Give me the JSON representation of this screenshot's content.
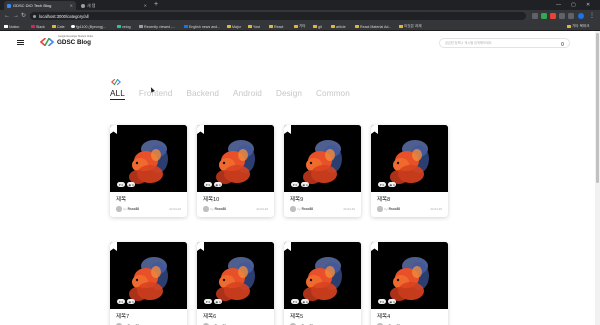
{
  "browser": {
    "tabs": [
      {
        "title": "GDSC DIO Tech Blog",
        "favicon_color": "#4285f4"
      },
      {
        "title": "새 탭",
        "favicon_color": "#9aa0a6"
      }
    ],
    "new_tab": "+",
    "window_controls": [
      "—",
      "▢",
      "✕"
    ],
    "url": "localhost:3000/category/all",
    "bookmarks": [
      {
        "label": "Notion",
        "color": "#ffffff"
      },
      {
        "label": "Slack",
        "color": "#e01e5a"
      },
      {
        "label": "Cafe",
        "color": "#e2b33f"
      },
      {
        "label": "fjp1100 (Byeongj...",
        "color": "#ffffff"
      },
      {
        "label": "velog",
        "color": "#20c997"
      },
      {
        "label": "Recently viewed -...",
        "color": "#9aa0a6"
      },
      {
        "label": "English news and...",
        "color": "#1a73e8"
      },
      {
        "label": "Major",
        "color": "#e2b33f"
      },
      {
        "label": "Yost",
        "color": "#e2b33f"
      },
      {
        "label": "React",
        "color": "#e2b33f"
      },
      {
        "label": "기타",
        "color": "#e2b33f"
      },
      {
        "label": "git",
        "color": "#e2b33f"
      },
      {
        "label": "article",
        "color": "#e2b33f"
      },
      {
        "label": "React Material Ad...",
        "color": "#e2b33f"
      },
      {
        "label": "이것은 과제",
        "color": "#e2b33f"
      }
    ],
    "other_bookmarks": "기타 북마크"
  },
  "header": {
    "logo_small": "Google Developer Student Clubs",
    "logo_text": "GDSC Blog",
    "search_placeholder": "궁금한 정보나 게시물 검색해보세요"
  },
  "categories": [
    {
      "label": "ALL",
      "active": true
    },
    {
      "label": "Frontend",
      "active": false
    },
    {
      "label": "Backend",
      "active": false
    },
    {
      "label": "Android",
      "active": false
    },
    {
      "label": "Design",
      "active": false
    },
    {
      "label": "Common",
      "active": false
    }
  ],
  "posts": [
    {
      "title": "제목",
      "author": "Rsoc88",
      "by": "by",
      "date": "22.04.20",
      "likes": "♥ 0",
      "views": "◉ 0"
    },
    {
      "title": "제목10",
      "author": "Rsoc88",
      "by": "by",
      "date": "22.04.20",
      "likes": "♥ 0",
      "views": "◉ 0"
    },
    {
      "title": "제목9",
      "author": "Rsoc88",
      "by": "by",
      "date": "22.04.20",
      "likes": "♥ 0",
      "views": "◉ 0"
    },
    {
      "title": "제목8",
      "author": "Rsoc88",
      "by": "by",
      "date": "22.04.20",
      "likes": "♥ 0",
      "views": "◉ 0"
    },
    {
      "title": "제목7",
      "author": "Rsoc88",
      "by": "by",
      "date": "22.04.20",
      "likes": "♥ 0",
      "views": "◉ 0"
    },
    {
      "title": "제목6",
      "author": "Rsoc88",
      "by": "by",
      "date": "22.04.20",
      "likes": "♥ 0",
      "views": "◉ 0"
    },
    {
      "title": "제목5",
      "author": "Rsoc88",
      "by": "by",
      "date": "22.04.20",
      "likes": "♥ 0",
      "views": "◉ 0"
    },
    {
      "title": "제목4",
      "author": "Rsoc88",
      "by": "by",
      "date": "22.04.20",
      "likes": "♥ 0",
      "views": "◉ 0"
    }
  ],
  "colors": {
    "accent_green": "#34a853",
    "accent_blue": "#4285f4",
    "accent_red": "#ea4335",
    "accent_yellow": "#fbbc04",
    "fish_orange": "#e8502a"
  }
}
